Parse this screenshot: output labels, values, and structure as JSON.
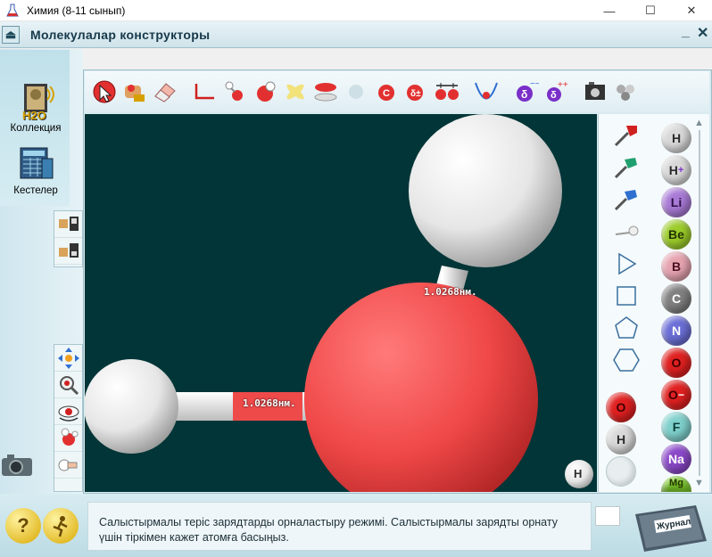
{
  "window": {
    "title": "Химия (8-11 сынып)",
    "minimize": "—",
    "maximize": "☐",
    "close": "✕"
  },
  "header": {
    "title": "Молекулалар конструкторы",
    "up_icon": "⏏",
    "minimize_glyph": "_",
    "close_glyph": "✕"
  },
  "sidebar": {
    "collection_label": "Коллекция",
    "collection_icon_text": "H2O",
    "tables_label": "Кестелер"
  },
  "viewport": {
    "bond_labels": [
      "1.0268нм.",
      "1.0268нм."
    ],
    "corner_atom": "H",
    "background": "#023537"
  },
  "palette": {
    "atoms": [
      {
        "symbol": "H",
        "color": "#d9d9d9",
        "text_color": "#2b2b2b"
      },
      {
        "symbol": "H",
        "sup": "+",
        "color": "#d9d9d9",
        "text_color": "#2b2b2b"
      },
      {
        "symbol": "Li",
        "color": "#a97ad6",
        "text_color": "#2b1044"
      },
      {
        "symbol": "Be",
        "color": "#9ccc2a",
        "text_color": "#233300"
      },
      {
        "symbol": "B",
        "color": "#e6a3b0",
        "text_color": "#4a1020"
      },
      {
        "symbol": "C",
        "color": "#808080",
        "text_color": "#ffffff"
      },
      {
        "symbol": "N",
        "color": "#6b6fd6",
        "text_color": "#ffffff"
      },
      {
        "symbol": "O",
        "color": "#e02020",
        "text_color": "#400000"
      },
      {
        "symbol": "O",
        "sup": "−",
        "color": "#e02020",
        "text_color": "#400000"
      },
      {
        "symbol": "F",
        "color": "#7fd0cc",
        "text_color": "#0c3b39"
      },
      {
        "symbol": "Na",
        "color": "#8a48c8",
        "text_color": "#ffffff"
      },
      {
        "symbol": "Mg",
        "color": "#7ccc2a",
        "text_color": "#233300"
      }
    ],
    "selected_atoms": [
      "O",
      "H"
    ]
  },
  "hint": {
    "text": "Салыстырмалы теріс зарядтарды орналастыру режимі. Салыстырмалы зарядты орнату үшін тіркімен кажет атомға басыңыз."
  },
  "bottom": {
    "help_glyph": "?",
    "journal_label": "Журнал"
  },
  "toolbar": {
    "charge_plus": "δ±",
    "delta": "δ"
  }
}
